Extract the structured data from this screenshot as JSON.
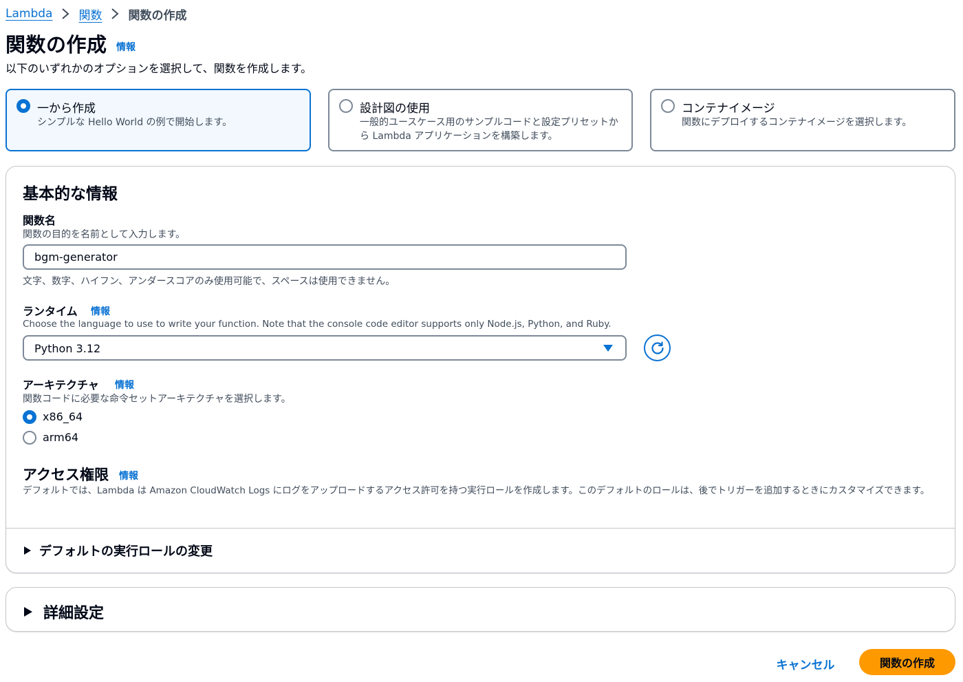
{
  "breadcrumb": {
    "items": [
      "Lambda",
      "関数"
    ],
    "current": "関数の作成"
  },
  "header": {
    "title": "関数の作成",
    "info": "情報",
    "subtitle": "以下のいずれかのオプションを選択して、関数を作成します。"
  },
  "options": [
    {
      "title": "一から作成",
      "desc": "シンプルな Hello World の例で開始します。",
      "selected": true
    },
    {
      "title": "設計図の使用",
      "desc": "一般的ユースケース用のサンプルコードと設定プリセットから Lambda アプリケーションを構築します。",
      "selected": false
    },
    {
      "title": "コンテナイメージ",
      "desc": "関数にデプロイするコンテナイメージを選択します。",
      "selected": false
    }
  ],
  "basic": {
    "heading": "基本的な情報",
    "function_name": {
      "label": "関数名",
      "desc": "関数の目的を名前として入力します。",
      "value": "bgm-generator",
      "constraint": "文字、数字、ハイフン、アンダースコアのみ使用可能で、スペースは使用できません。"
    },
    "runtime": {
      "label": "ランタイム",
      "info": "情報",
      "desc": "Choose the language to use to write your function. Note that the console code editor supports only Node.js, Python, and Ruby.",
      "value": "Python 3.12"
    },
    "architecture": {
      "label": "アーキテクチャ",
      "info": "情報",
      "desc": "関数コードに必要な命令セットアーキテクチャを選択します。",
      "options": [
        {
          "label": "x86_64",
          "selected": true
        },
        {
          "label": "arm64",
          "selected": false
        }
      ]
    },
    "permissions": {
      "label": "アクセス権限",
      "info": "情報",
      "desc": "デフォルトでは、Lambda は Amazon CloudWatch Logs にログをアップロードするアクセス許可を持つ実行ロールを作成します。このデフォルトのロールは、後でトリガーを追加するときにカスタマイズできます。"
    },
    "role_expander": "デフォルトの実行ロールの変更"
  },
  "advanced": {
    "label": "詳細設定"
  },
  "footer": {
    "cancel": "キャンセル",
    "create": "関数の作成"
  },
  "colors": {
    "accent": "#0972d3",
    "primary_button": "#ff9900"
  }
}
